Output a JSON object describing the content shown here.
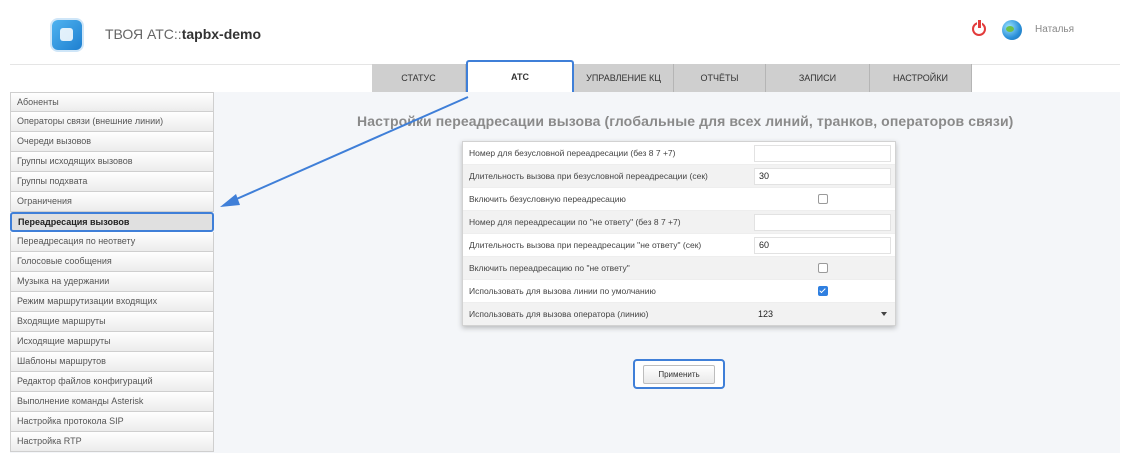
{
  "header": {
    "app_title_prefix": "ТВОЯ АТС::",
    "app_title_name": "tapbx-demo",
    "user_name": "Наталья",
    "icons": {
      "power": "power-icon",
      "globe": "globe-icon"
    }
  },
  "tabs": [
    {
      "label": "СТАТУС",
      "active": false
    },
    {
      "label": "АТС",
      "active": true
    },
    {
      "label": "УПРАВЛЕНИЕ КЦ",
      "active": false
    },
    {
      "label": "ОТЧЁТЫ",
      "active": false
    },
    {
      "label": "ЗАПИСИ",
      "active": false
    },
    {
      "label": "НАСТРОЙКИ",
      "active": false
    }
  ],
  "sidebar": {
    "items": [
      {
        "label": "Абоненты"
      },
      {
        "label": "Операторы связи (внешние линии)"
      },
      {
        "label": "Очереди вызовов"
      },
      {
        "label": "Группы исходящих вызовов"
      },
      {
        "label": "Группы подхвата"
      },
      {
        "label": "Ограничения"
      },
      {
        "label": "Переадресация вызовов",
        "active": true
      },
      {
        "label": "Переадресация по неответу"
      },
      {
        "label": "Голосовые сообщения"
      },
      {
        "label": "Музыка на удержании"
      },
      {
        "label": "Режим маршрутизации входящих"
      },
      {
        "label": "Входящие маршруты"
      },
      {
        "label": "Исходящие маршруты"
      },
      {
        "label": "Шаблоны маршрутов"
      },
      {
        "label": "Редактор файлов конфигураций"
      },
      {
        "label": "Выполнение команды Asterisk"
      },
      {
        "label": "Настройка протокола SIP"
      },
      {
        "label": "Настройка RTP"
      }
    ]
  },
  "main": {
    "title": "Настройки переадресации вызова (глобальные для всех линий, транков, операторов связи)",
    "form": {
      "rows": [
        {
          "label": "Номер для безусловной переадресации (без 8 7 +7)",
          "type": "text",
          "value": ""
        },
        {
          "label": "Длительность вызова при безусловной переадресации (сек)",
          "type": "text",
          "value": "30"
        },
        {
          "label": "Включить безусловную переадресацию",
          "type": "checkbox",
          "checked": false
        },
        {
          "label": "Номер для переадресации по \"не ответу\" (без 8 7 +7)",
          "type": "text",
          "value": ""
        },
        {
          "label": "Длительность вызова при переадресации \"не ответу\" (сек)",
          "type": "text",
          "value": "60"
        },
        {
          "label": "Включить переадресацию по \"не ответу\"",
          "type": "checkbox",
          "checked": false
        },
        {
          "label": "Использовать для вызова линии по умолчанию",
          "type": "checkbox",
          "checked": true
        },
        {
          "label": "Использовать для вызова оператора (линию)",
          "type": "select",
          "value": "123"
        }
      ]
    },
    "apply_label": "Применить"
  },
  "colors": {
    "highlight": "#3f7fd8",
    "tab_bg": "#cfcfcf",
    "checkbox_on": "#2f7fe0",
    "power_icon": "#e23b3b"
  }
}
